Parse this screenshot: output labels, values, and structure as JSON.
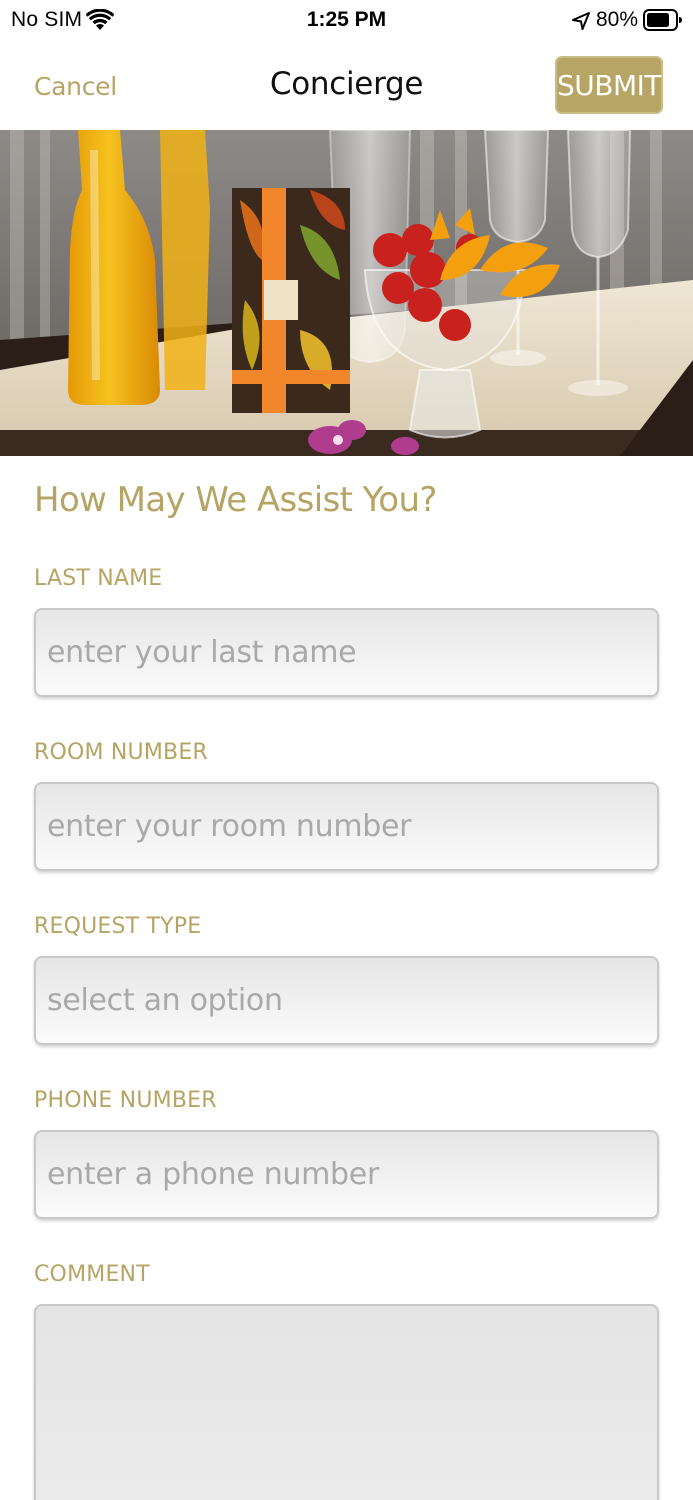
{
  "status_bar": {
    "carrier": "No SIM",
    "time": "1:25 PM",
    "battery_percent": "80%",
    "icons": [
      "wifi-icon",
      "location-arrow-icon",
      "battery-icon"
    ]
  },
  "nav": {
    "cancel_label": "Cancel",
    "title": "Concierge",
    "submit_label": "SUBMIT"
  },
  "hero_image": {
    "description_icon": "breakfast-tray-photo"
  },
  "form": {
    "heading": "How May We Assist You?",
    "fields": [
      {
        "label": "LAST NAME",
        "placeholder": "enter your last name",
        "value": ""
      },
      {
        "label": "ROOM NUMBER",
        "placeholder": "enter your room number",
        "value": ""
      },
      {
        "label": "REQUEST TYPE",
        "placeholder": "select an option",
        "value": ""
      },
      {
        "label": "PHONE NUMBER",
        "placeholder": "enter a phone number",
        "value": ""
      },
      {
        "label": "COMMENT",
        "placeholder": "",
        "value": ""
      }
    ]
  },
  "colors": {
    "accent": "#b5a464",
    "submit_bg": "#b7a565",
    "title_text": "#111111",
    "placeholder": "#a9a9a9",
    "field_border": "#c8c8c8"
  }
}
